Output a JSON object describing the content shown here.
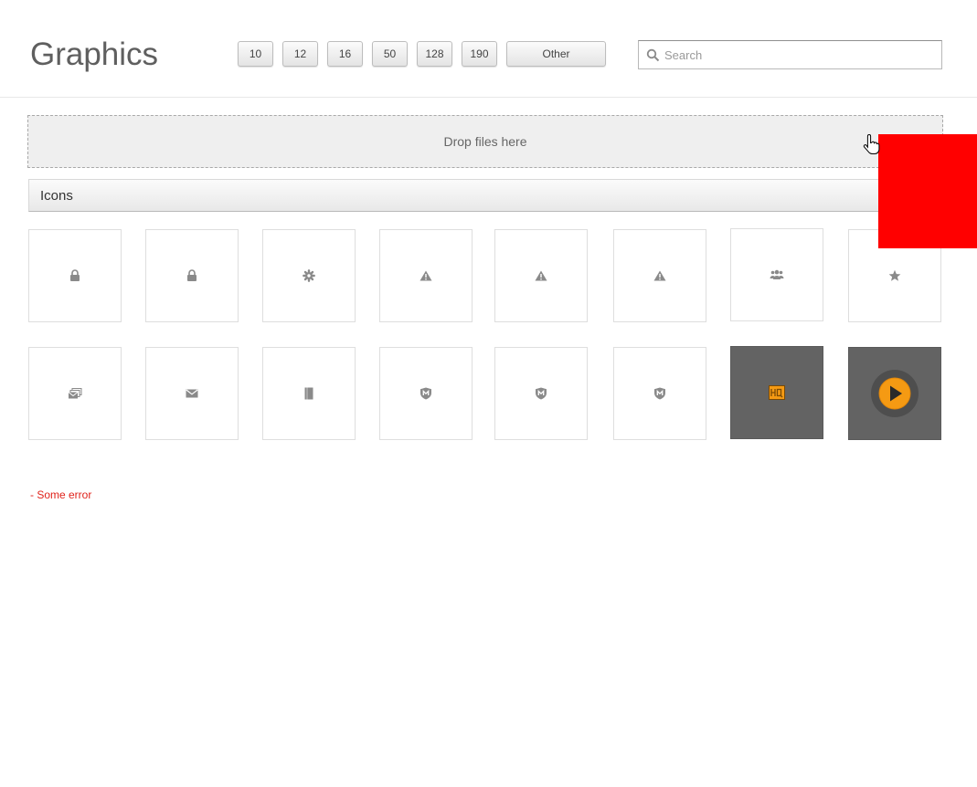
{
  "header": {
    "title": "Graphics",
    "size_buttons": [
      "10",
      "12",
      "16",
      "50",
      "128",
      "190",
      "Other"
    ],
    "search": {
      "placeholder": "Search",
      "value": ""
    }
  },
  "dropzone": {
    "label": "Drop files here"
  },
  "section": {
    "title": "Icons"
  },
  "icons": [
    "lock-icon",
    "lock-icon",
    "gear-icon",
    "warning-icon",
    "warning-icon",
    "warning-icon",
    "users-icon",
    "star-icon",
    "windows-stack-icon",
    "envelope-icon",
    "document-icon",
    "shield-icon",
    "shield-icon",
    "shield-icon",
    "hq-badge-icon",
    "play-circle-icon"
  ],
  "error": {
    "message": "- Some error"
  },
  "colors": {
    "accent_orange": "#f59a13",
    "error_red": "#e0231b",
    "overlay_red": "#ff0000",
    "dark_tile": "#636363"
  }
}
